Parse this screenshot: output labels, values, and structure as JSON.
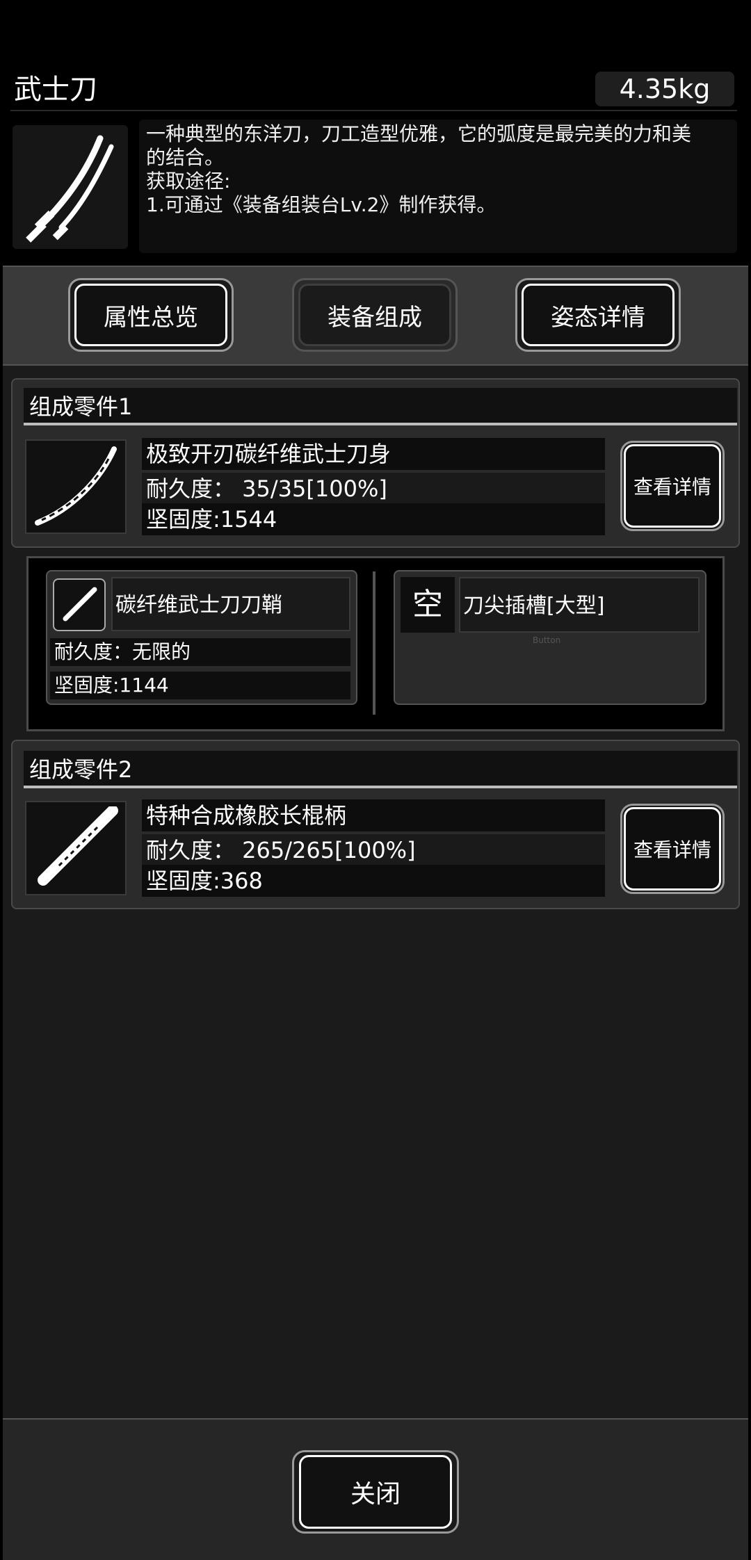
{
  "item": {
    "name": "武士刀",
    "weight": "4.35kg",
    "description": [
      "一种典型的东洋刀，刀工造型优雅，它的弧度是最完美的力和美",
      "的结合。",
      "获取途径:",
      "1.可通过《装备组装台Lv.2》制作获得。"
    ]
  },
  "tabs": [
    {
      "label": "属性总览"
    },
    {
      "label": "装备组成"
    },
    {
      "label": "姿态详情"
    }
  ],
  "parts": [
    {
      "header": "组成零件1",
      "name": "极致开刃碳纤维武士刀身",
      "durability": "耐久度：  35/35[100%]",
      "hardness": "坚固度:1544",
      "detail_label": "查看详情"
    },
    {
      "header": "组成零件2",
      "name": "特种合成橡胶长棍柄",
      "durability": "耐久度：  265/265[100%]",
      "hardness": "坚固度:368",
      "detail_label": "查看详情"
    }
  ],
  "subparts": {
    "scabbard": {
      "name": "碳纤维武士刀刀鞘",
      "durability": "耐久度：无限的",
      "hardness": "坚固度:1144"
    },
    "slot": {
      "empty_label": "空",
      "name": "刀尖插槽[大型]",
      "faint_label": "Button"
    }
  },
  "footer": {
    "close_label": "关闭"
  }
}
